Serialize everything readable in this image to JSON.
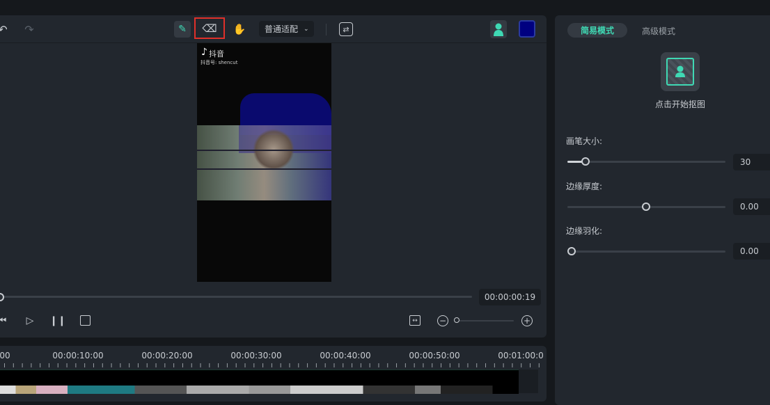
{
  "toolbar": {
    "fit_select": "普通适配",
    "icons": [
      "undo-icon",
      "redo-icon",
      "smart-brush-icon",
      "eraser-icon",
      "hand-icon",
      "swap-icon",
      "person-icon",
      "color-swatch-icon"
    ],
    "selected_tool": "eraser",
    "color_swatch": "#000080"
  },
  "video": {
    "brand": "抖音",
    "account": "抖音号: shencut"
  },
  "player": {
    "timecode": "00:00:00:19",
    "progress": 0.0
  },
  "timeline": {
    "ticks": [
      ":00",
      "00:00:10:00",
      "00:00:20:00",
      "00:00:30:00",
      "00:00:40:00",
      "00:00:50:00",
      "00:01:00:0"
    ]
  },
  "right_panel": {
    "tabs": [
      {
        "label": "简易模式",
        "active": true
      },
      {
        "label": "高级模式",
        "active": false
      }
    ],
    "start_label": "点击开始抠图",
    "sliders": [
      {
        "label": "画笔大小:",
        "value": "30",
        "fraction": 0.1
      },
      {
        "label": "边缘厚度:",
        "value": "0.00",
        "fraction": 0.5
      },
      {
        "label": "边缘羽化:",
        "value": "0.00",
        "fraction": 0.0
      }
    ]
  },
  "colors": {
    "accent": "#3fd9b4",
    "panel": "#22272e",
    "background": "#15181c"
  }
}
